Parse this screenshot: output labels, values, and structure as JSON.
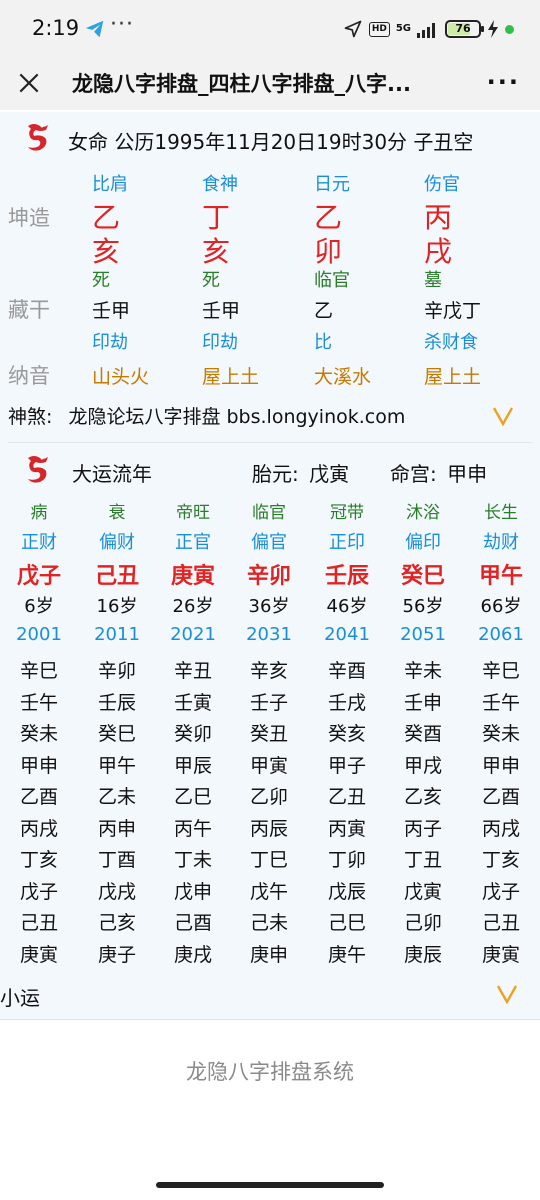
{
  "status": {
    "time": "2:19",
    "dots": "···",
    "hd": "HD",
    "net": "5G",
    "battery": "76"
  },
  "nav": {
    "title": "龙隐八字排盘_四柱八字排盘_八字...",
    "more": "···"
  },
  "header": {
    "gender": "女命",
    "calendar": "公历1995年11月20日19时30分",
    "kong": "子丑空"
  },
  "pillars": {
    "label": "坤造",
    "cols": [
      {
        "god": "比肩",
        "stem": "乙",
        "branch": "亥",
        "stage": "死"
      },
      {
        "god": "食神",
        "stem": "丁",
        "branch": "亥",
        "stage": "死"
      },
      {
        "god": "日元",
        "stem": "乙",
        "branch": "卯",
        "stage": "临官"
      },
      {
        "god": "伤官",
        "stem": "丙",
        "branch": "戌",
        "stage": "墓"
      }
    ]
  },
  "hidden": {
    "label": "藏干",
    "cols": [
      {
        "stems": "壬甲",
        "gods": "印劫"
      },
      {
        "stems": "壬甲",
        "gods": "印劫"
      },
      {
        "stems": "乙",
        "gods": "比"
      },
      {
        "stems": "辛戊丁",
        "gods": "杀财食"
      }
    ]
  },
  "nayin": {
    "label": "纳音",
    "values": [
      "山头火",
      "屋上土",
      "大溪水",
      "屋上土"
    ]
  },
  "shensha": {
    "label": "神煞:",
    "text": "龙隐论坛八字排盘 bbs.longyinok.com"
  },
  "dayun": {
    "title": "大运流年",
    "taiyuan_label": "胎元:",
    "taiyuan": "戊寅",
    "minggong_label": "命宫:",
    "minggong": "甲申",
    "cols": [
      {
        "state": "病",
        "god": "正财",
        "gz": "戊子",
        "age": "6岁",
        "year": "2001",
        "years": [
          "辛巳",
          "壬午",
          "癸未",
          "甲申",
          "乙酉",
          "丙戌",
          "丁亥",
          "戊子",
          "己丑",
          "庚寅"
        ]
      },
      {
        "state": "衰",
        "god": "偏财",
        "gz": "己丑",
        "age": "16岁",
        "year": "2011",
        "years": [
          "辛卯",
          "壬辰",
          "癸巳",
          "甲午",
          "乙未",
          "丙申",
          "丁酉",
          "戊戌",
          "己亥",
          "庚子"
        ]
      },
      {
        "state": "帝旺",
        "god": "正官",
        "gz": "庚寅",
        "age": "26岁",
        "year": "2021",
        "years": [
          "辛丑",
          "壬寅",
          "癸卯",
          "甲辰",
          "乙巳",
          "丙午",
          "丁未",
          "戊申",
          "己酉",
          "庚戌"
        ]
      },
      {
        "state": "临官",
        "god": "偏官",
        "gz": "辛卯",
        "age": "36岁",
        "year": "2031",
        "years": [
          "辛亥",
          "壬子",
          "癸丑",
          "甲寅",
          "乙卯",
          "丙辰",
          "丁巳",
          "戊午",
          "己未",
          "庚申"
        ]
      },
      {
        "state": "冠带",
        "god": "正印",
        "gz": "壬辰",
        "age": "46岁",
        "year": "2041",
        "years": [
          "辛酉",
          "壬戌",
          "癸亥",
          "甲子",
          "乙丑",
          "丙寅",
          "丁卯",
          "戊辰",
          "己巳",
          "庚午"
        ]
      },
      {
        "state": "沐浴",
        "god": "偏印",
        "gz": "癸巳",
        "age": "56岁",
        "year": "2051",
        "years": [
          "辛未",
          "壬申",
          "癸酉",
          "甲戌",
          "乙亥",
          "丙子",
          "丁丑",
          "戊寅",
          "己卯",
          "庚辰"
        ]
      },
      {
        "state": "长生",
        "god": "劫财",
        "gz": "甲午",
        "age": "66岁",
        "year": "2061",
        "years": [
          "辛巳",
          "壬午",
          "癸未",
          "甲申",
          "乙酉",
          "丙戌",
          "丁亥",
          "戊子",
          "己丑",
          "庚寅"
        ]
      }
    ]
  },
  "xiaoyun": {
    "label": "小运"
  },
  "footer": {
    "text": "龙隐八字排盘系统"
  },
  "colors": {
    "blue": "#1a8fd6",
    "red": "#e02424",
    "green": "#2a7d2a",
    "orange": "#c57a00"
  },
  "icons": {
    "close": "close-icon",
    "more": "more-icon",
    "dragon": "dragon-logo-icon",
    "expand": "chevron-down-icon"
  }
}
